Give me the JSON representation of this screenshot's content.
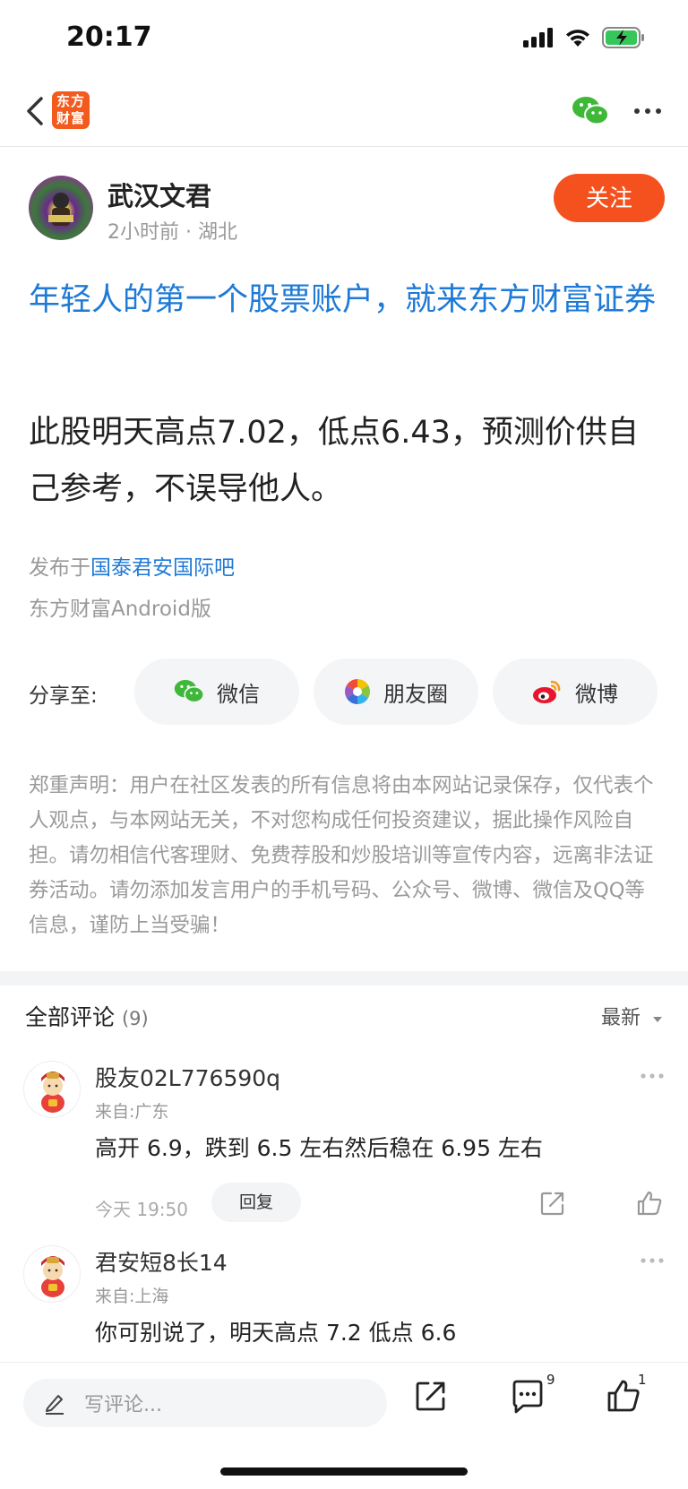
{
  "status_bar": {
    "time": "20:17"
  },
  "nav": {
    "logo_line1": "东方",
    "logo_line2": "财富"
  },
  "author": {
    "name": "武汉文君",
    "meta": "2小时前 · 湖北",
    "follow_label": "关注"
  },
  "ad_title": "年轻人的第一个股票账户，就来东方财富证券",
  "post": {
    "body": "此股明天高点7.02，低点6.43，预测价供自己参考，不误导他人。",
    "published_prefix": "发布于",
    "published_bar": "国泰君安国际吧",
    "client": "东方财富Android版"
  },
  "share": {
    "label": "分享至:",
    "targets": [
      {
        "label": "微信",
        "icon": "wechat-icon"
      },
      {
        "label": "朋友圈",
        "icon": "moments-icon"
      },
      {
        "label": "微博",
        "icon": "weibo-icon"
      }
    ]
  },
  "disclaimer": "郑重声明：用户在社区发表的所有信息将由本网站记录保存，仅代表个人观点，与本网站无关，不对您构成任何投资建议，据此操作风险自担。请勿相信代客理财、免费荐股和炒股培训等宣传内容，远离非法证券活动。请勿添加发言用户的手机号码、公众号、微博、微信及QQ等信息，谨防上当受骗！",
  "comments": {
    "title": "全部评论",
    "count": "(9)",
    "sort_label": "最新",
    "items": [
      {
        "name": "股友02L776590q",
        "location": "来自:广东",
        "text": "高开 6.9，跌到 6.5 左右然后稳在 6.95 左右",
        "time": "今天 19:50",
        "reply_label": "回复"
      },
      {
        "name": "君安短8长14",
        "location": "来自:上海",
        "text": "你可别说了，明天高点 7.2  低点 6.6"
      }
    ]
  },
  "bottom_bar": {
    "input_placeholder": "写评论...",
    "comment_count": "9",
    "like_count": "1"
  },
  "colors": {
    "accent_orange": "#f5511e",
    "link_blue": "#1e7ad6",
    "wechat_green": "#3fb83a"
  }
}
